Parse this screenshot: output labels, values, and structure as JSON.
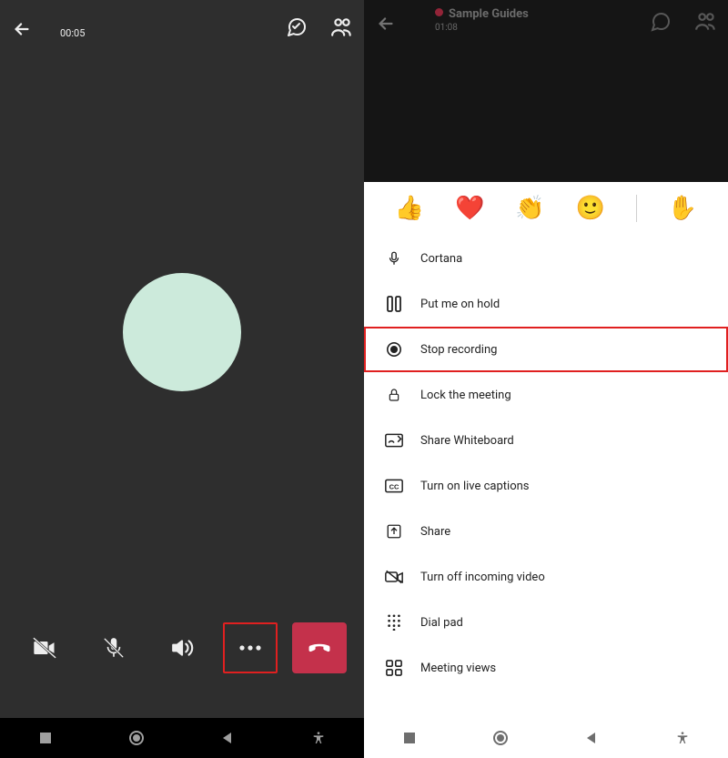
{
  "left": {
    "timer": "00:05"
  },
  "right": {
    "title": "Sample Guides",
    "timer": "01:08",
    "reactions": [
      "thumbs-up",
      "heart",
      "clap",
      "smile",
      "raise-hand"
    ],
    "menu": [
      {
        "icon": "mic",
        "label": "Cortana"
      },
      {
        "icon": "pause",
        "label": "Put me on hold"
      },
      {
        "icon": "record",
        "label": "Stop recording",
        "highlight": true
      },
      {
        "icon": "lock",
        "label": "Lock the meeting"
      },
      {
        "icon": "whiteboard",
        "label": "Share Whiteboard"
      },
      {
        "icon": "cc",
        "label": "Turn on live captions"
      },
      {
        "icon": "share",
        "label": "Share"
      },
      {
        "icon": "video-off",
        "label": "Turn off incoming video"
      },
      {
        "icon": "dialpad",
        "label": "Dial pad"
      },
      {
        "icon": "views",
        "label": "Meeting views"
      }
    ]
  }
}
